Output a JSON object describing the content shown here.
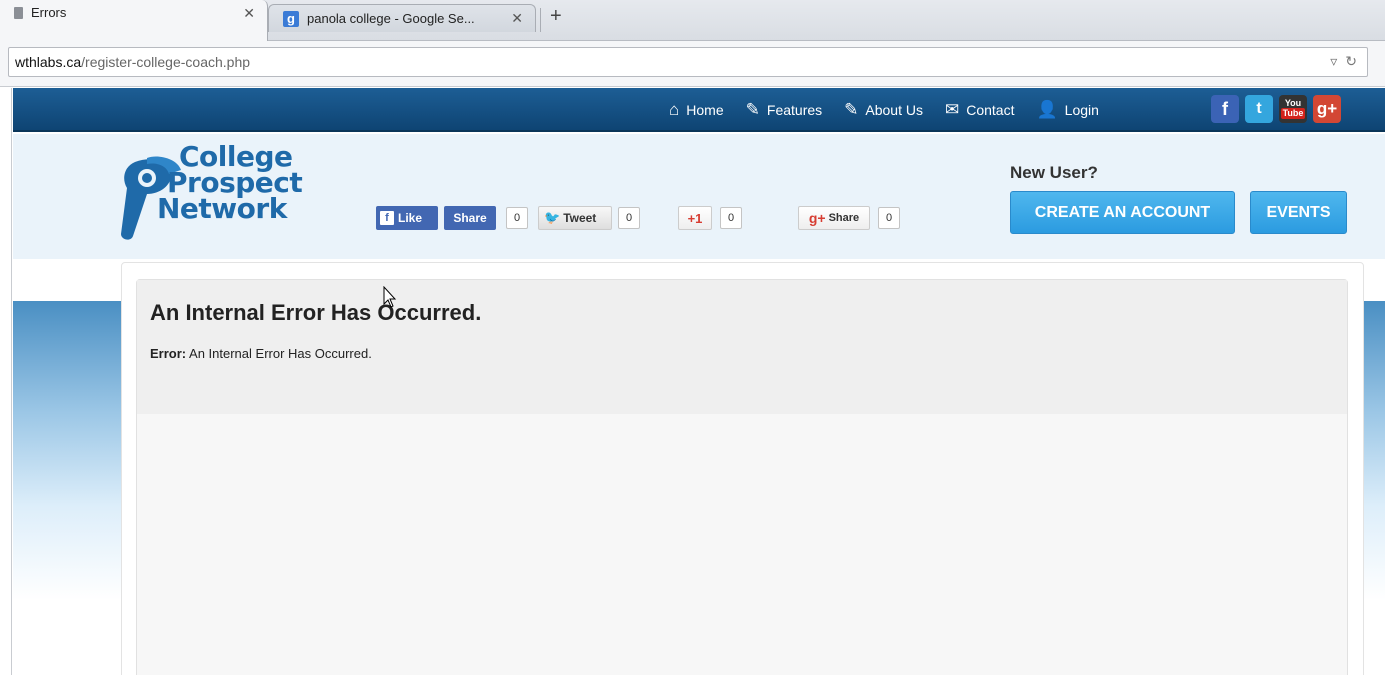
{
  "browser": {
    "tabs": [
      {
        "title": "Errors",
        "close": "✕"
      },
      {
        "title": "panola college - Google Se...",
        "close": "✕",
        "favicon": "g"
      }
    ],
    "new_tab": "+",
    "url_host": "wthlabs.ca",
    "url_path": "/register-college-coach.php"
  },
  "nav": {
    "items": [
      {
        "label": "Home",
        "icon": "home-icon"
      },
      {
        "label": "Features",
        "icon": "edit-icon"
      },
      {
        "label": "About Us",
        "icon": "edit-icon"
      },
      {
        "label": "Contact",
        "icon": "mail-icon"
      },
      {
        "label": "Login",
        "icon": "user-icon"
      }
    ],
    "social": [
      {
        "label": "f",
        "name": "facebook"
      },
      {
        "label": "t",
        "name": "twitter"
      },
      {
        "label": "You",
        "label2": "Tube",
        "name": "youtube"
      },
      {
        "label": "g+",
        "name": "google-plus"
      }
    ]
  },
  "logo": {
    "line1": "College",
    "line2": "Prospect",
    "line3": "Network"
  },
  "share": {
    "like": "Like",
    "share": "Share",
    "share_count": "0",
    "tweet": "Tweet",
    "tweet_count": "0",
    "gplus": "+1",
    "gplus_count": "0",
    "gshare": "Share",
    "gshare_count": "0"
  },
  "account": {
    "new_user": "New User?",
    "create": "CREATE AN ACCOUNT",
    "events": "EVENTS"
  },
  "error": {
    "title": "An Internal Error Has Occurred.",
    "label": "Error:",
    "message": "An Internal Error Has Occurred."
  },
  "colors": {
    "nav_bg": "#1d5e95",
    "button_blue": "#3aa7e8",
    "logo_blue": "#1f6aa9"
  }
}
